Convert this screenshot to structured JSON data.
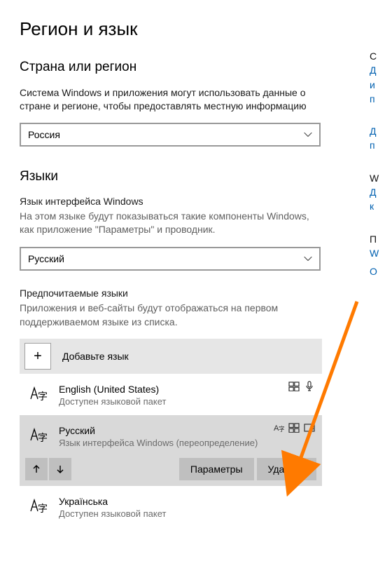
{
  "pageTitle": "Регион и язык",
  "regionSection": {
    "title": "Страна или регион",
    "desc": "Система Windows и приложения могут использовать данные о стране и регионе, чтобы предоставлять местную информацию",
    "value": "Россия"
  },
  "langSection": {
    "title": "Языки",
    "ifaceLabel": "Язык интерфейса Windows",
    "ifaceDesc": "На этом языке будут показываться такие компоненты Windows, как приложение \"Параметры\" и проводник.",
    "ifaceValue": "Русский",
    "prefLabel": "Предпочитаемые языки",
    "prefDesc": "Приложения и веб-сайты будут отображаться на первом поддерживаемом языке из списка.",
    "addLabel": "Добавьте язык",
    "items": [
      {
        "name": "English (United States)",
        "sub": "Доступен языковой пакет"
      },
      {
        "name": "Русский",
        "sub": "Язык интерфейса Windows (переопределение)"
      },
      {
        "name": "Українська",
        "sub": "Доступен языковой пакет"
      }
    ],
    "paramsBtn": "Параметры",
    "deleteBtn": "Удалить"
  },
  "rightLinks": {
    "hdr1": "С",
    "l1a": "Д",
    "l1b": "и",
    "l1c": "п",
    "l2a": "Д",
    "l2b": "п",
    "hdr2": "W",
    "l3a": "Д",
    "l3b": "к",
    "hdr3": "П",
    "l4": "W",
    "l5": "О"
  },
  "arrowColor": "#ff7a00"
}
